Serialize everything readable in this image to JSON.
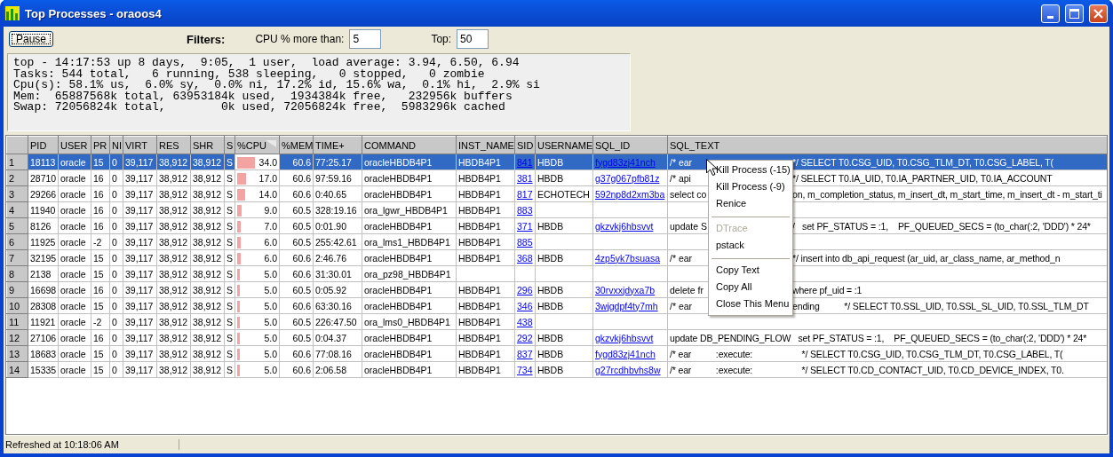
{
  "window": {
    "title": "Top Processes - oraoos4"
  },
  "toolbar": {
    "pause_button": "Pause",
    "filters_label": "Filters:",
    "cpu_filter": {
      "label": "CPU % more than:",
      "value": "5"
    },
    "top_filter": {
      "label": "Top:",
      "value": "50"
    }
  },
  "summary": [
    "top - 14:17:53 up 8 days,  9:05,  1 user,  load average: 3.94, 6.50, 6.94",
    "Tasks: 544 total,   6 running, 538 sleeping,   0 stopped,   0 zombie",
    "Cpu(s): 58.1% us,  6.0% sy,  0.0% ni, 17.2% id, 15.6% wa,  0.1% hi,  2.9% si",
    "Mem:  65887568k total, 63953184k used,  1934384k free,   232956k buffers",
    "Swap: 72056824k total,        0k used, 72056824k free,  5983296k cached"
  ],
  "table": {
    "columns": [
      {
        "label": "PID",
        "sorted": false
      },
      {
        "label": "USER",
        "sorted": false
      },
      {
        "label": "PR",
        "sorted": false
      },
      {
        "label": "NI",
        "sorted": false
      },
      {
        "label": "VIRT",
        "sorted": false
      },
      {
        "label": "RES",
        "sorted": false
      },
      {
        "label": "SHR",
        "sorted": false
      },
      {
        "label": "S",
        "sorted": false
      },
      {
        "label": "%CPU",
        "sorted": true
      },
      {
        "label": "%MEM",
        "sorted": false
      },
      {
        "label": "TIME+",
        "sorted": false
      },
      {
        "label": "COMMAND",
        "sorted": false
      },
      {
        "label": "INST_NAME",
        "sorted": false
      },
      {
        "label": "SID",
        "sorted": false
      },
      {
        "label": "USERNAME",
        "sorted": false
      },
      {
        "label": "SQL_ID",
        "sorted": false
      },
      {
        "label": "SQL_TEXT",
        "sorted": false
      }
    ],
    "rows": [
      {
        "num": "1",
        "selected": true,
        "pid": "18113",
        "user": "oracle",
        "pr": "15",
        "ni": "0",
        "virt": "39,117",
        "res": "38,912",
        "shr": "38,912",
        "s": "S",
        "cpu": "34.0",
        "level": 0.45,
        "mem": "60.6",
        "time": "77:25.17",
        "command": "oracleHBDB4P1",
        "inst_name": "HBDB4P1",
        "sid": "841",
        "username": "HBDB",
        "sql_id": "fygd83zj41nch",
        "sql_text": [
          "/* ear",
          "*/ SELECT T0.CSG_UID, T0.CSG_TLM_DT, T0.CSG_LABEL, T("
        ]
      },
      {
        "num": "2",
        "selected": false,
        "pid": "28710",
        "user": "oracle",
        "pr": "16",
        "ni": "0",
        "virt": "39,117",
        "res": "38,912",
        "shr": "38,912",
        "s": "S",
        "cpu": "17.0",
        "level": 0.23,
        "mem": "60.6",
        "time": "97:59.16",
        "command": "oracleHBDB4P1",
        "inst_name": "HBDB4P1",
        "sid": "381",
        "username": "HBDB",
        "sql_id": "g37g067pfb81z",
        "sql_text": [
          "/* api",
          "*/ SELECT T0.IA_UID, T0.IA_PARTNER_UID, T0.IA_ACCOUNT"
        ]
      },
      {
        "num": "3",
        "selected": false,
        "pid": "29266",
        "user": "oracle",
        "pr": "16",
        "ni": "0",
        "virt": "39,117",
        "res": "38,912",
        "shr": "38,912",
        "s": "S",
        "cpu": "14.0",
        "level": 0.19,
        "mem": "60.6",
        "time": "0:40.65",
        "command": "oracleHBDB4P1",
        "inst_name": "HBDB4P1",
        "sid": "817",
        "username": "ECHOTECH",
        "sql_id": "592np8d2xm3ba",
        "sql_text": [
          "select co",
          "on, m_completion_status, m_insert_dt, m_start_time, m_insert_dt - m_start_ti"
        ]
      },
      {
        "num": "4",
        "selected": false,
        "pid": "11940",
        "user": "oracle",
        "pr": "16",
        "ni": "0",
        "virt": "39,117",
        "res": "38,912",
        "shr": "38,912",
        "s": "S",
        "cpu": "9.0",
        "level": 0.12,
        "mem": "60.5",
        "time": "328:19.16",
        "command": "ora_lgwr_HBDB4P1",
        "inst_name": "HBDB4P1",
        "sid": "883"
      },
      {
        "num": "5",
        "selected": false,
        "pid": "8126",
        "user": "oracle",
        "pr": "16",
        "ni": "0",
        "virt": "39,117",
        "res": "38,912",
        "shr": "38,912",
        "s": "S",
        "cpu": "7.0",
        "level": 0.09,
        "mem": "60.5",
        "time": "0:01.90",
        "command": "oracleHBDB4P1",
        "inst_name": "HBDB4P1",
        "sid": "371",
        "username": "HBDB",
        "sql_id": "gkzvkj6hbsvvt",
        "sql_text": [
          "update S",
          "/   set PF_STATUS = :1,    PF_QUEUED_SECS = (to_char(:2, 'DDD') * 24*"
        ]
      },
      {
        "num": "6",
        "selected": false,
        "pid": "11925",
        "user": "oracle",
        "pr": "-2",
        "ni": "0",
        "virt": "39,117",
        "res": "38,912",
        "shr": "38,912",
        "s": "S",
        "cpu": "6.0",
        "level": 0.08,
        "mem": "60.5",
        "time": "255:42.61",
        "command": "ora_lms1_HBDB4P1",
        "inst_name": "HBDB4P1",
        "sid": "885"
      },
      {
        "num": "7",
        "selected": false,
        "pid": "32195",
        "user": "oracle",
        "pr": "15",
        "ni": "0",
        "virt": "39,117",
        "res": "38,912",
        "shr": "38,912",
        "s": "S",
        "cpu": "6.0",
        "level": 0.08,
        "mem": "60.6",
        "time": "2:46.76",
        "command": "oracleHBDB4P1",
        "inst_name": "HBDB4P1",
        "sid": "368",
        "username": "HBDB",
        "sql_id": "4zp5yk7bsuasa",
        "sql_text": [
          "/* ear",
          "*/ insert into db_api_request (ar_uid, ar_class_name, ar_method_n"
        ]
      },
      {
        "num": "8",
        "selected": false,
        "pid": "2138",
        "user": "oracle",
        "pr": "15",
        "ni": "0",
        "virt": "39,117",
        "res": "38,912",
        "shr": "38,912",
        "s": "S",
        "cpu": "5.0",
        "level": 0.06,
        "mem": "60.6",
        "time": "31:30.01",
        "command": "ora_pz98_HBDB4P1"
      },
      {
        "num": "9",
        "selected": false,
        "pid": "16698",
        "user": "oracle",
        "pr": "16",
        "ni": "0",
        "virt": "39,117",
        "res": "38,912",
        "shr": "38,912",
        "s": "S",
        "cpu": "5.0",
        "level": 0.06,
        "mem": "60.5",
        "time": "0:05.92",
        "command": "oracleHBDB4P1",
        "inst_name": "HBDB4P1",
        "sid": "296",
        "username": "HBDB",
        "sql_id": "30rvxxjdyxa7b",
        "sql_text": [
          "delete fr",
          "where pf_uid = :1"
        ]
      },
      {
        "num": "10",
        "selected": false,
        "pid": "28308",
        "user": "oracle",
        "pr": "15",
        "ni": "0",
        "virt": "39,117",
        "res": "38,912",
        "shr": "38,912",
        "s": "S",
        "cpu": "5.0",
        "level": 0.06,
        "mem": "60.6",
        "time": "63:30.16",
        "command": "oracleHBDB4P1",
        "inst_name": "HBDB4P1",
        "sid": "346",
        "username": "HBDB",
        "sql_id": "3wjgdpf4ty7mh",
        "sql_text": [
          "/* ear",
          "ending          */ SELECT T0.SSL_UID, T0.SSL_SL_UID, T0.SSL_TLM_DT"
        ]
      },
      {
        "num": "11",
        "selected": false,
        "pid": "11921",
        "user": "oracle",
        "pr": "-2",
        "ni": "0",
        "virt": "39,117",
        "res": "38,912",
        "shr": "38,912",
        "s": "S",
        "cpu": "5.0",
        "level": 0.06,
        "mem": "60.5",
        "time": "226:47.50",
        "command": "ora_lms0_HBDB4P1",
        "inst_name": "HBDB4P1",
        "sid": "438"
      },
      {
        "num": "12",
        "selected": false,
        "pid": "27106",
        "user": "oracle",
        "pr": "16",
        "ni": "0",
        "virt": "39,117",
        "res": "38,912",
        "shr": "38,912",
        "s": "S",
        "cpu": "5.0",
        "level": 0.06,
        "mem": "60.5",
        "time": "0:04.37",
        "command": "oracleHBDB4P1",
        "inst_name": "HBDB4P1",
        "sid": "292",
        "username": "HBDB",
        "sql_id": "gkzvkj6hbsvvt",
        "sql_text": [
          "update DB_PENDING_FLOW   set PF_STATUS = :1,    PF_QUEUED_SECS = (to_char(:2, 'DDD') * 24*"
        ]
      },
      {
        "num": "13",
        "selected": false,
        "pid": "18683",
        "user": "oracle",
        "pr": "15",
        "ni": "0",
        "virt": "39,117",
        "res": "38,912",
        "shr": "38,912",
        "s": "S",
        "cpu": "5.0",
        "level": 0.06,
        "mem": "60.6",
        "time": "77:08.16",
        "command": "oracleHBDB4P1",
        "inst_name": "HBDB4P1",
        "sid": "837",
        "username": "HBDB",
        "sql_id": "fygd83zj41nch",
        "sql_text": [
          "/* ear          :execute:                    */ SELECT T0.CSG_UID, T0.CSG_TLM_DT, T0.CSG_LABEL, T("
        ]
      },
      {
        "num": "14",
        "selected": false,
        "pid": "15335",
        "user": "oracle",
        "pr": "15",
        "ni": "0",
        "virt": "39,117",
        "res": "38,912",
        "shr": "38,912",
        "s": "S",
        "cpu": "5.0",
        "level": 0.06,
        "mem": "60.6",
        "time": "2:06.58",
        "command": "oracleHBDB4P1",
        "inst_name": "HBDB4P1",
        "sid": "734",
        "username": "HBDB",
        "sql_id": "g27rcdhbvhs8w",
        "sql_text": [
          "/* ear          :execute:                    */ SELECT T0.CD_CONTACT_UID, T0.CD_DEVICE_INDEX, T0."
        ]
      }
    ]
  },
  "context_menu": [
    {
      "kind": "item",
      "label": "Kill Process (-15)",
      "disabled": false
    },
    {
      "kind": "item",
      "label": "Kill Process (-9)",
      "disabled": false
    },
    {
      "kind": "item",
      "label": "Renice",
      "disabled": false
    },
    {
      "kind": "separator"
    },
    {
      "kind": "item",
      "label": "DTrace",
      "disabled": true
    },
    {
      "kind": "item",
      "label": "pstack",
      "disabled": false
    },
    {
      "kind": "separator"
    },
    {
      "kind": "item",
      "label": "Copy Text",
      "disabled": false
    },
    {
      "kind": "item",
      "label": "Copy All",
      "disabled": false
    },
    {
      "kind": "item",
      "label": "Close This Menu",
      "disabled": false
    }
  ],
  "status_bar": {
    "text": "Refreshed at 10:18:06 AM"
  }
}
